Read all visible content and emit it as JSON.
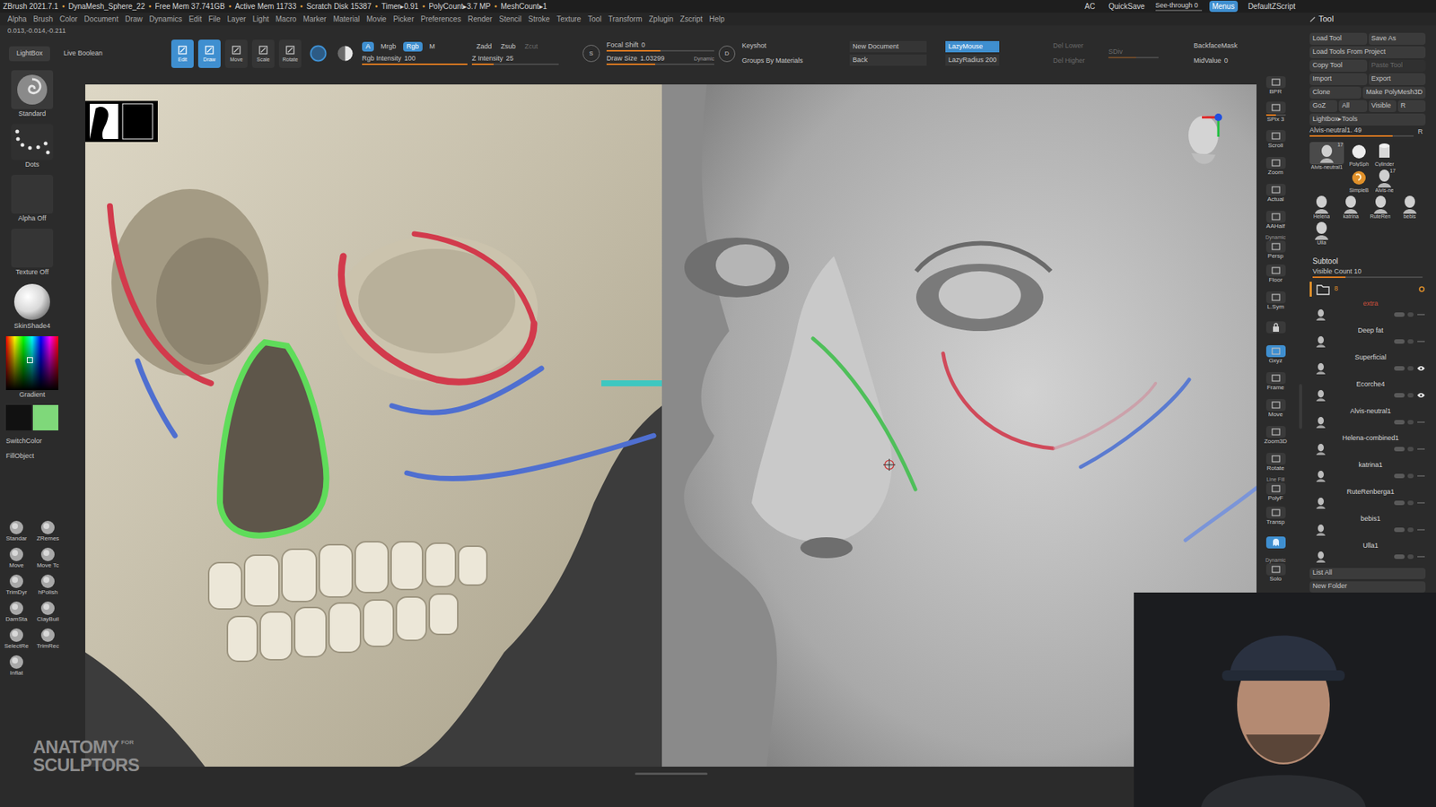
{
  "title_bar": {
    "segments": [
      "ZBrush 2021.7.1",
      "DynaMesh_Sphere_22",
      "Free Mem 37.741GB",
      "Active Mem 11733",
      "Scratch Disk 15387",
      "Timer▸0.91",
      "PolyCount▸3.7 MP",
      "MeshCount▸1"
    ],
    "separator": "•",
    "right": [
      {
        "label": "AC",
        "kind": "button",
        "selected": false
      },
      {
        "label": "QuickSave",
        "kind": "button",
        "selected": false
      },
      {
        "label": "See-through 0",
        "kind": "slider",
        "selected": false,
        "level": 0
      },
      {
        "label": "Menus",
        "kind": "button",
        "selected": true
      },
      {
        "label": "DefaultZScript",
        "kind": "button",
        "selected": false
      }
    ]
  },
  "menus": [
    "Alpha",
    "Brush",
    "Color",
    "Document",
    "Draw",
    "Dynamics",
    "Edit",
    "File",
    "Layer",
    "Light",
    "Macro",
    "Marker",
    "Material",
    "Movie",
    "Picker",
    "Preferences",
    "Render",
    "Stencil",
    "Stroke",
    "Texture",
    "Tool",
    "Transform",
    "Zplugin",
    "Zscript",
    "Help"
  ],
  "coords": "0.013,-0.014,-0.211",
  "shelf": {
    "left_buttons": [
      "LightBox",
      "Live Boolean"
    ],
    "modes": [
      {
        "label": "Edit",
        "selected": true
      },
      {
        "label": "Draw",
        "selected": true
      },
      {
        "label": "Move",
        "selected": false
      },
      {
        "label": "Scale",
        "selected": false
      },
      {
        "label": "Rotate",
        "selected": false
      }
    ],
    "color_modes": [
      {
        "label": "A",
        "selected": true
      },
      {
        "label": "Mrgb",
        "selected": false
      },
      {
        "label": "Rgb",
        "selected": true
      },
      {
        "label": "M",
        "selected": false
      }
    ],
    "z_modes": [
      {
        "label": "Zadd",
        "selected": false,
        "disabled": false
      },
      {
        "label": "Zsub",
        "selected": false,
        "disabled": false
      },
      {
        "label": "Zcut",
        "selected": false,
        "disabled": true
      }
    ],
    "sliders": [
      {
        "label": "Rgb Intensity",
        "value": "100",
        "level": 1
      },
      {
        "label": "Z Intensity",
        "value": "25",
        "level": 0.25
      },
      {
        "label": "Focal Shift",
        "value": "0",
        "level": 0.5
      },
      {
        "label": "Draw Size",
        "value": "1.03299",
        "level": 0.45
      }
    ],
    "dynamic": "Dynamic",
    "focal_icon": "S",
    "draw_icon": "D",
    "keyshot": [
      "Keyshot",
      "Groups By Materials"
    ],
    "doc_buttons": [
      "New Document",
      "Back"
    ],
    "lazy": {
      "label": "LazyMouse",
      "selected": true,
      "radius": "LazyRadius 200"
    },
    "del": [
      {
        "label": "Del Lower",
        "disabled": true
      },
      {
        "label": "Del Higher",
        "disabled": true
      }
    ],
    "sdiv": {
      "label": "SDiv",
      "disabled": true,
      "level": 0.55
    },
    "backface": {
      "label": "BackfaceMask",
      "selected": false
    },
    "midvalue": {
      "label": "MidValue",
      "value": "0"
    }
  },
  "left_panel": {
    "brush": "Standard",
    "stroke": "Dots",
    "alpha": "Alpha Off",
    "texture": "Texture Off",
    "material": "SkinShade4",
    "gradient": "Gradient",
    "swatches": [
      {
        "color": "#111111"
      },
      {
        "color": "#7fd87a"
      }
    ],
    "switch": "SwitchColor",
    "fill": "FillObject",
    "brushes": [
      "Standar",
      "ZRemes",
      "Move",
      "Move Tc",
      "TrimDyr",
      "hPolish",
      "DamSta",
      "ClayBuil",
      "SelectRe",
      "TrimRec",
      "Inflat"
    ]
  },
  "watermark": [
    "ANATOMY",
    "FOR",
    "SCULPTORS"
  ],
  "right_strip": [
    {
      "label": "BPR",
      "kind": "button",
      "selected": false
    },
    {
      "label": "SPix 3",
      "kind": "slider",
      "selected": false,
      "level": 0.5
    },
    {
      "label": "Scroll",
      "kind": "button",
      "selected": false
    },
    {
      "label": "Zoom",
      "kind": "button",
      "selected": false
    },
    {
      "label": "Actual",
      "kind": "button",
      "selected": false
    },
    {
      "label": "AAHalf",
      "kind": "button",
      "selected": false
    },
    {
      "label": "Persp",
      "sub": "Dynamic",
      "kind": "button",
      "selected": false
    },
    {
      "label": "Floor",
      "kind": "button",
      "selected": false
    },
    {
      "label": "L.Sym",
      "kind": "button",
      "selected": false
    },
    {
      "kind": "lock",
      "selected": false
    },
    {
      "label": "Gxyz",
      "kind": "button",
      "selected": true
    },
    {
      "label": "Frame",
      "kind": "button",
      "selected": false
    },
    {
      "label": "Move",
      "kind": "button",
      "selected": false
    },
    {
      "label": "Zoom3D",
      "kind": "button",
      "selected": false
    },
    {
      "label": "Rotate",
      "kind": "button",
      "selected": false
    },
    {
      "label": "PolyF",
      "sub": "Line Fill",
      "kind": "button",
      "selected": false
    },
    {
      "label": "Transp",
      "kind": "button",
      "selected": false
    },
    {
      "kind": "ghost",
      "selected": true
    },
    {
      "label": "Solo",
      "sub": "Dynamic",
      "kind": "button",
      "selected": false
    }
  ],
  "tool_panel": {
    "title": "Tool",
    "rows": [
      [
        {
          "label": "Load Tool",
          "disabled": false
        },
        {
          "label": "Save As",
          "disabled": false
        }
      ],
      [
        {
          "label": "Load Tools From Project",
          "disabled": false
        }
      ],
      [
        {
          "label": "Copy Tool",
          "disabled": false
        },
        {
          "label": "Paste Tool",
          "disabled": true
        }
      ],
      [
        {
          "label": "Import",
          "disabled": false
        },
        {
          "label": "Export",
          "disabled": false
        }
      ],
      [
        {
          "label": "Clone",
          "disabled": false
        },
        {
          "label": "Make PolyMesh3D",
          "disabled": false
        }
      ],
      [
        {
          "label": "GoZ",
          "disabled": false
        },
        {
          "label": "All",
          "disabled": false
        },
        {
          "label": "Visible",
          "disabled": false
        },
        {
          "label": "R",
          "disabled": false
        }
      ],
      [
        {
          "label": "Lightbox▸Tools",
          "disabled": false
        }
      ]
    ],
    "current_tool": {
      "label": "Alvis-neutral1. 49",
      "level": 0.8,
      "r": "R"
    },
    "thumbnails": [
      {
        "label": "Alvis-neutral1",
        "count": "17",
        "kind": "head",
        "selected": true
      },
      {
        "label": "PolySph",
        "kind": "sphere",
        "selected": false
      },
      {
        "label": "Cylinder",
        "kind": "cylinder",
        "selected": false
      },
      {
        "label": "SimpleB",
        "kind": "brush",
        "selected": false
      },
      {
        "label": "Alvis-ne",
        "count": "17",
        "kind": "head",
        "selected": false
      },
      {
        "label": "Helena",
        "kind": "head",
        "selected": false
      },
      {
        "label": "katrina",
        "kind": "head",
        "selected": false
      },
      {
        "label": "RuteRen",
        "kind": "head",
        "selected": false
      },
      {
        "label": "bebis",
        "kind": "head",
        "selected": false
      },
      {
        "label": "Ulla",
        "kind": "head",
        "selected": false
      }
    ],
    "subtool": {
      "title": "Subtool",
      "visible_count": "Visible Count 10",
      "level": 0.3,
      "folder": {
        "count": "8",
        "selected": true
      },
      "items": [
        {
          "name": "extra",
          "visible": false,
          "color": "#d0503c"
        },
        {
          "name": "Deep fat",
          "visible": false,
          "color": "#d8d8d8"
        },
        {
          "name": "Superficial",
          "visible": true,
          "color": "#d8d8d8"
        },
        {
          "name": "Ecorche4",
          "visible": true,
          "color": "#d8d8d8"
        },
        {
          "name": "Alvis-neutral1",
          "visible": false,
          "color": "#d8d8d8"
        },
        {
          "name": "Helena-combined1",
          "visible": false,
          "color": "#d8d8d8"
        },
        {
          "name": "katrina1",
          "visible": false,
          "color": "#d8d8d8"
        },
        {
          "name": "RuteRenberga1",
          "visible": false,
          "color": "#d8d8d8"
        },
        {
          "name": "bebis1",
          "visible": false,
          "color": "#d8d8d8"
        },
        {
          "name": "Ulla1",
          "visible": false,
          "color": "#d8d8d8"
        }
      ]
    },
    "footer": [
      "List All",
      "New Folder"
    ]
  }
}
